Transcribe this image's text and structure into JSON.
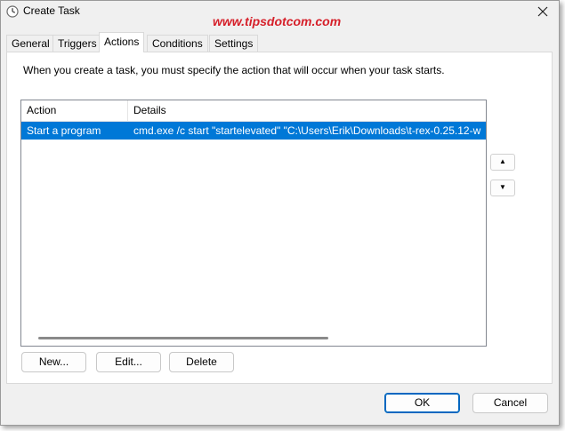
{
  "window": {
    "title": "Create Task",
    "watermark": "www.tipsdotcom.com",
    "close_label": "✕"
  },
  "tabs": [
    {
      "label": "General"
    },
    {
      "label": "Triggers"
    },
    {
      "label": "Actions",
      "active": true
    },
    {
      "label": "Conditions"
    },
    {
      "label": "Settings"
    }
  ],
  "actions_panel": {
    "description": "When you create a task, you must specify the action that will occur when your task starts.",
    "columns": {
      "action": "Action",
      "details": "Details"
    },
    "rows": [
      {
        "action": "Start a program",
        "details": "cmd.exe /c start \"startelevated\" \"C:\\Users\\Erik\\Downloads\\t-rex-0.25.12-w",
        "selected": true
      }
    ],
    "move_up_label": "▲",
    "move_down_label": "▼",
    "new_label": "New...",
    "edit_label": "Edit...",
    "delete_label": "Delete"
  },
  "footer": {
    "ok_label": "OK",
    "cancel_label": "Cancel"
  },
  "colors": {
    "selection": "#0078d7",
    "watermark": "#d6202a",
    "default_button_border": "#0067c0"
  },
  "icons": {
    "title": "clock-icon",
    "close": "close-icon",
    "move_up": "arrow-up-icon",
    "move_down": "arrow-down-icon"
  }
}
